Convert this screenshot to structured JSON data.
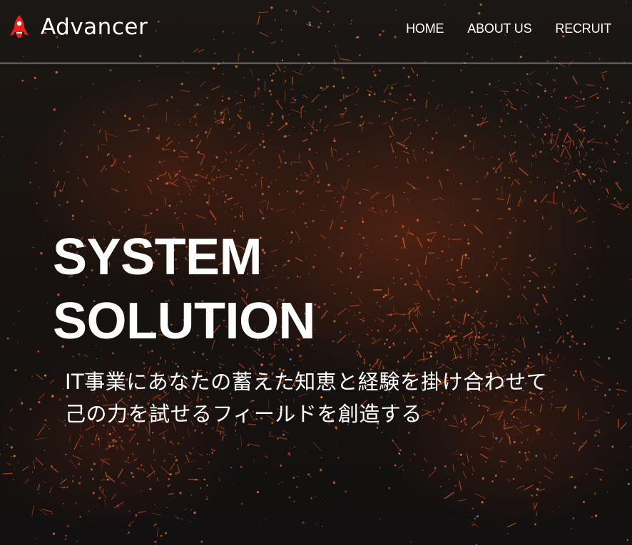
{
  "header": {
    "brand": "Advancer",
    "logo_icon": "rocket-icon",
    "nav": [
      {
        "label": "HOME"
      },
      {
        "label": "ABOUT US"
      },
      {
        "label": "RECRUIT"
      }
    ]
  },
  "hero": {
    "headline_line1": "SYSTEM",
    "headline_line2": "SOLUTION",
    "tagline_line1": "IT事業にあなたの蓄えた知恵と経験を掛け合わせて",
    "tagline_line2": "己の力を試せるフィールドを創造する"
  },
  "colors": {
    "accent": "#e5231b",
    "text": "#ffffff",
    "background": "#141210",
    "city_light": "#d9542a"
  }
}
